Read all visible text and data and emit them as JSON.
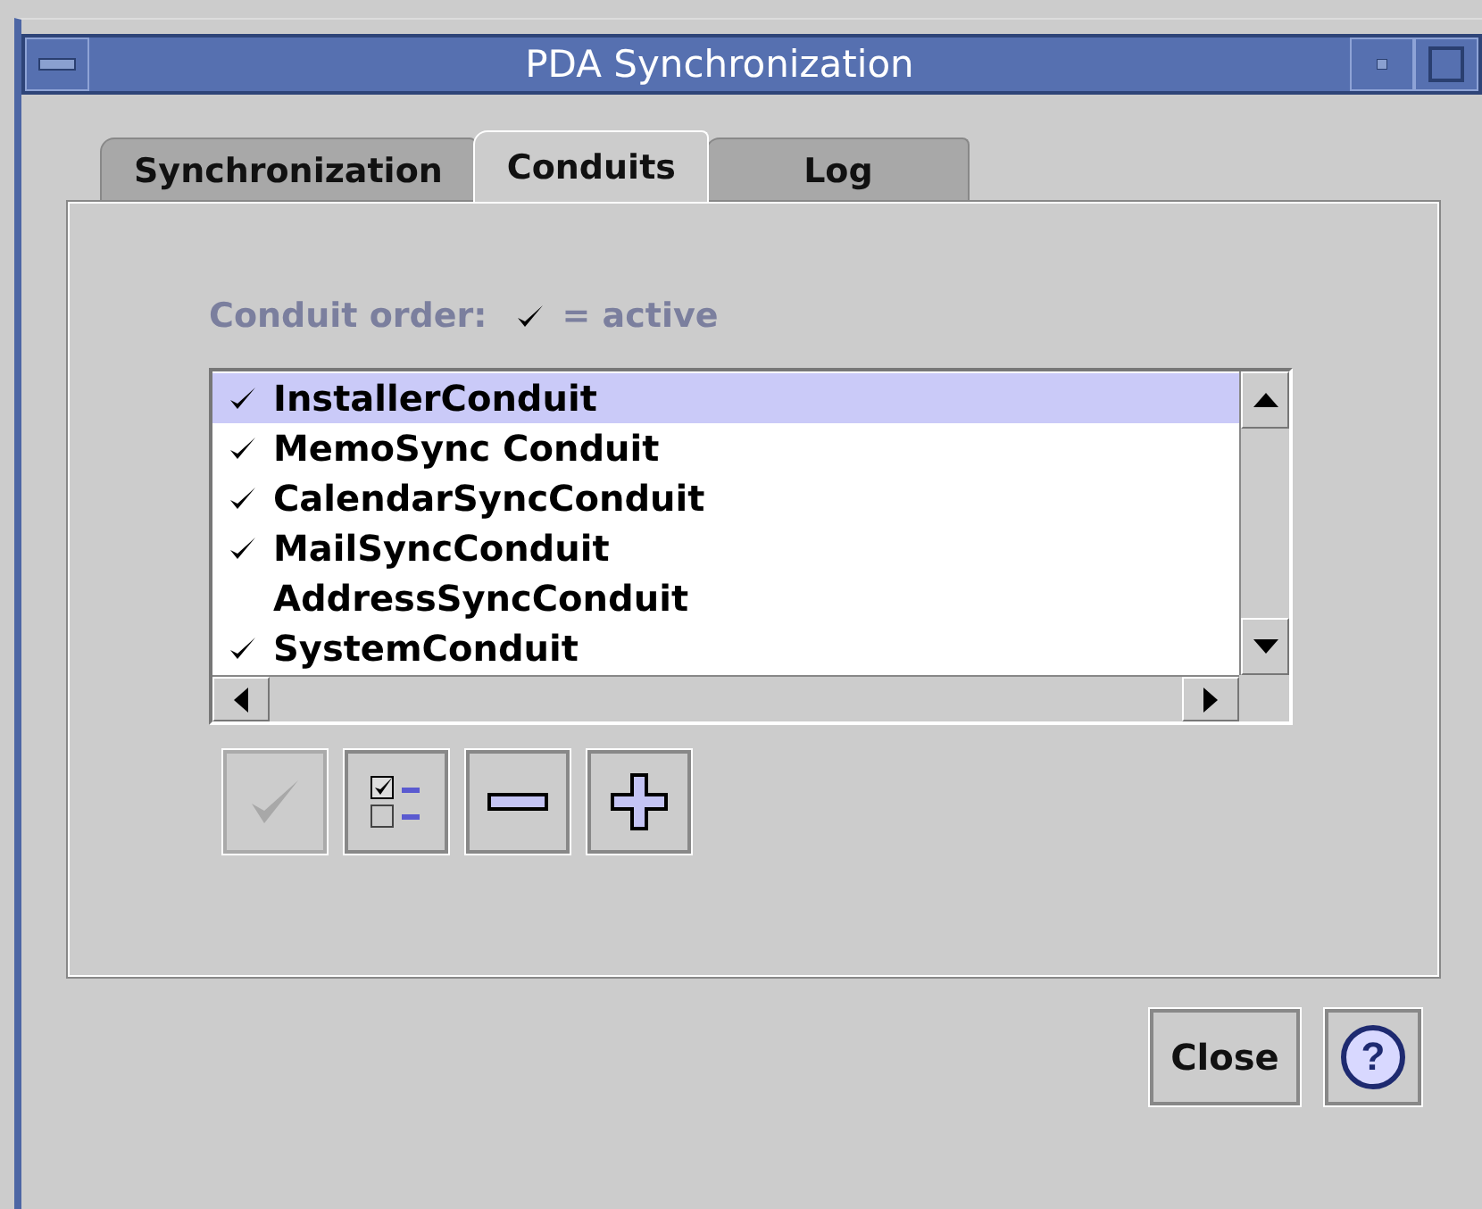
{
  "window": {
    "title": "PDA Synchronization"
  },
  "tabs": [
    {
      "label": "Synchronization",
      "selected": false
    },
    {
      "label": "Conduits",
      "selected": true
    },
    {
      "label": "Log",
      "selected": false
    }
  ],
  "conduit_order": {
    "label": "Conduit order:",
    "legend": "= active"
  },
  "conduits": [
    {
      "name": "InstallerConduit",
      "active": true,
      "selected": true
    },
    {
      "name": "MemoSync Conduit",
      "active": true,
      "selected": false
    },
    {
      "name": "CalendarSyncConduit",
      "active": true,
      "selected": false
    },
    {
      "name": "MailSyncConduit",
      "active": true,
      "selected": false
    },
    {
      "name": "AddressSyncConduit",
      "active": false,
      "selected": false
    },
    {
      "name": "SystemConduit",
      "active": true,
      "selected": false
    }
  ],
  "tool_buttons": [
    {
      "kind": "activate",
      "disabled": true
    },
    {
      "kind": "checklist",
      "disabled": false
    },
    {
      "kind": "remove",
      "disabled": false
    },
    {
      "kind": "add",
      "disabled": false
    }
  ],
  "buttons": {
    "close": "Close",
    "help": "?"
  }
}
